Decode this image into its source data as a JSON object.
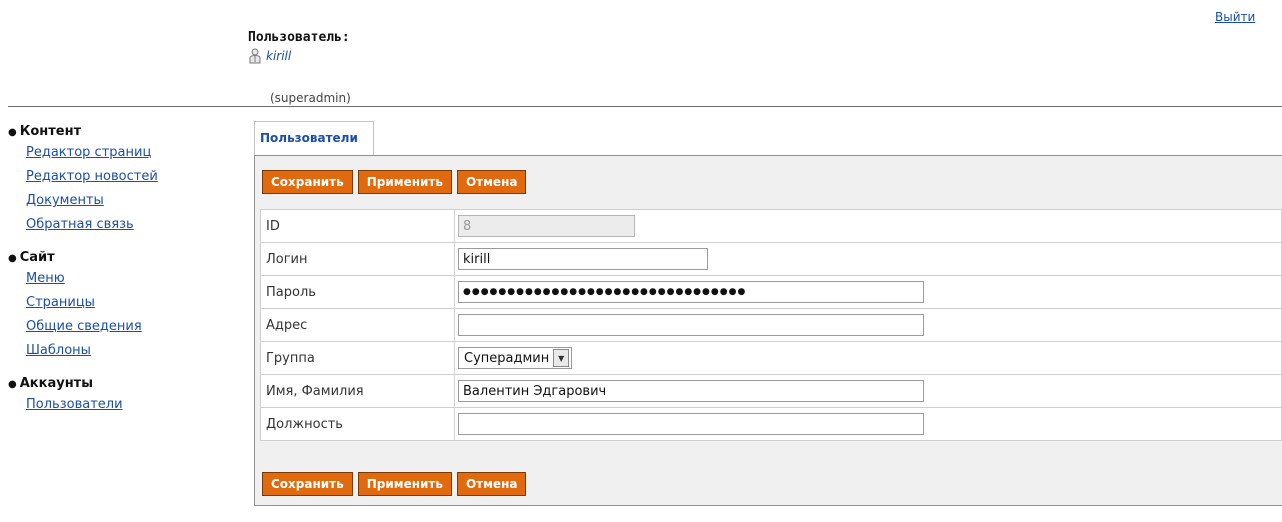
{
  "header": {
    "logout_label": "Выйти",
    "user_label": "Пользователь:",
    "user_name": "kirill",
    "user_role": "(superadmin)"
  },
  "sidebar": {
    "sections": [
      {
        "title": "Контент",
        "items": [
          "Редактор страниц",
          "Редактор новостей",
          "Документы",
          "Обратная связь"
        ]
      },
      {
        "title": "Сайт",
        "items": [
          "Меню",
          "Страницы",
          "Общие сведения",
          "Шаблоны"
        ]
      },
      {
        "title": "Аккаунты",
        "items": [
          "Пользователи"
        ]
      }
    ]
  },
  "tab": {
    "label": "Пользователи"
  },
  "buttons": {
    "save": "Сохранить",
    "apply": "Применить",
    "cancel": "Отмена"
  },
  "form": {
    "id": {
      "label": "ID",
      "value": "8"
    },
    "login": {
      "label": "Логин",
      "value": "kirill"
    },
    "password": {
      "label": "Пароль",
      "value": "●●●●●●●●●●●●●●●●●●●●●●●●●●●●●●●●"
    },
    "address": {
      "label": "Адрес",
      "value": ""
    },
    "group": {
      "label": "Группа",
      "value": "Суперадмин"
    },
    "fullname": {
      "label": "Имя, Фамилия",
      "value": "Валентин Эдгарович"
    },
    "position": {
      "label": "Должность",
      "value": ""
    }
  },
  "icons": {
    "user": "user-icon",
    "dropdown": "chevron-down-icon"
  }
}
